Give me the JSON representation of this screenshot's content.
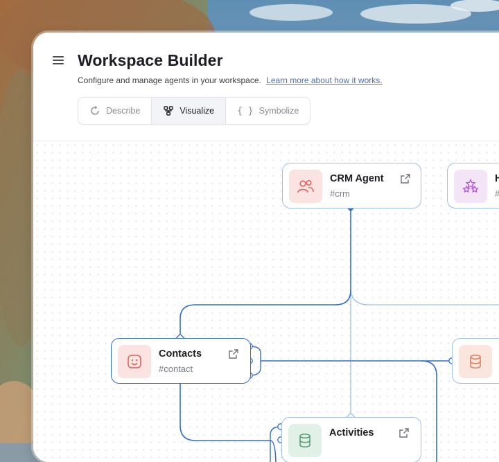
{
  "header": {
    "title": "Workspace Builder",
    "subtitle": "Configure and manage agents in your workspace.",
    "learn_more_link": "Learn more about how it works."
  },
  "tabs": [
    {
      "label": "Describe",
      "icon": "refresh-icon",
      "active": false
    },
    {
      "label": "Visualize",
      "icon": "flow-icon",
      "active": true
    },
    {
      "label": "Symbolize",
      "icon": "braces-icon",
      "active": false
    }
  ],
  "nodes": {
    "crm": {
      "name": "CRM Agent",
      "tag": "#crm",
      "icon": "users-icon",
      "icon_color": "#e0645a",
      "icon_bg": "#fbe3e1"
    },
    "h_agent": {
      "name": "H",
      "tag": "#",
      "icon": "stars-icon",
      "icon_color": "#b456d6",
      "icon_bg": "#f4e4f8"
    },
    "contacts": {
      "name": "Contacts",
      "tag": "#contact",
      "icon": "smile-icon",
      "icon_color": "#e0645a",
      "icon_bg": "#fbe3e1"
    },
    "db_right": {
      "name": "",
      "tag": "",
      "icon": "database-icon",
      "icon_color": "#e07a5a",
      "icon_bg": "#fbe6de"
    },
    "activities": {
      "name": "Activities",
      "tag": "",
      "icon": "database-icon",
      "icon_color": "#4f9a6e",
      "icon_bg": "#e1f1e7"
    }
  },
  "colors": {
    "edge": "#2f6fd0",
    "edge_light": "#9cc0ea",
    "accent": "#2f6fd0"
  }
}
